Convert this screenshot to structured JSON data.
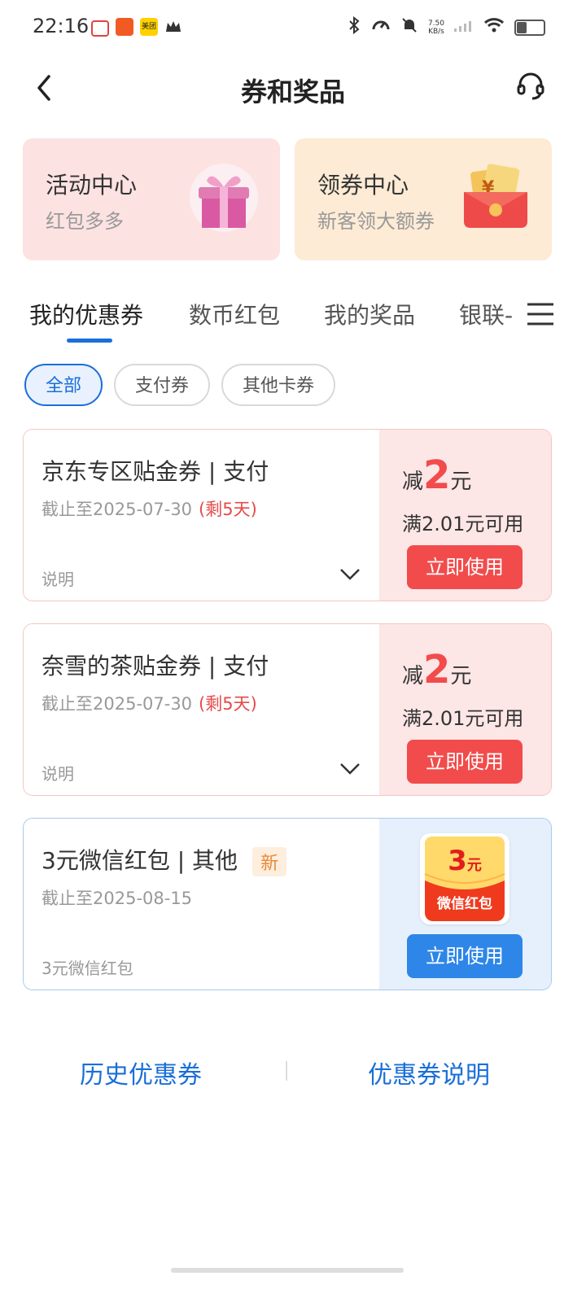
{
  "status_bar": {
    "time": "22:16",
    "net_speed_value": "7.50",
    "net_speed_unit": "KB/s",
    "app_icon_meituan": "美团"
  },
  "header": {
    "title": "券和奖品"
  },
  "entries": [
    {
      "title": "活动中心",
      "subtitle": "红包多多"
    },
    {
      "title": "领券中心",
      "subtitle": "新客领大额券"
    }
  ],
  "tabs": [
    "我的优惠券",
    "数币红包",
    "我的奖品",
    "银联-"
  ],
  "filters": [
    "全部",
    "支付券",
    "其他卡券"
  ],
  "coupons": [
    {
      "name": "京东专区贴金券 | 支付",
      "expiry": "截止至2025-07-30",
      "days_left": "(剩5天)",
      "note": "说明",
      "amount_prefix": "减",
      "amount": "2",
      "amount_unit": "元",
      "condition": "满2.01元可用",
      "button": "立即使用"
    },
    {
      "name": "奈雪的茶贴金券 | 支付",
      "expiry": "截止至2025-07-30",
      "days_left": "(剩5天)",
      "note": "说明",
      "amount_prefix": "减",
      "amount": "2",
      "amount_unit": "元",
      "condition": "满2.01元可用",
      "button": "立即使用"
    },
    {
      "name": "3元微信红包 | 其他",
      "badge": "新",
      "expiry": "截止至2025-08-15",
      "note": "3元微信红包",
      "packet_amount": "3",
      "packet_unit": "元",
      "packet_label": "微信红包",
      "button": "立即使用"
    }
  ],
  "footer": {
    "history": "历史优惠券",
    "explain": "优惠券说明"
  },
  "colors": {
    "accent_blue": "#1a6fd8",
    "accent_red": "#f24b4b",
    "button_blue": "#2d86e8"
  }
}
